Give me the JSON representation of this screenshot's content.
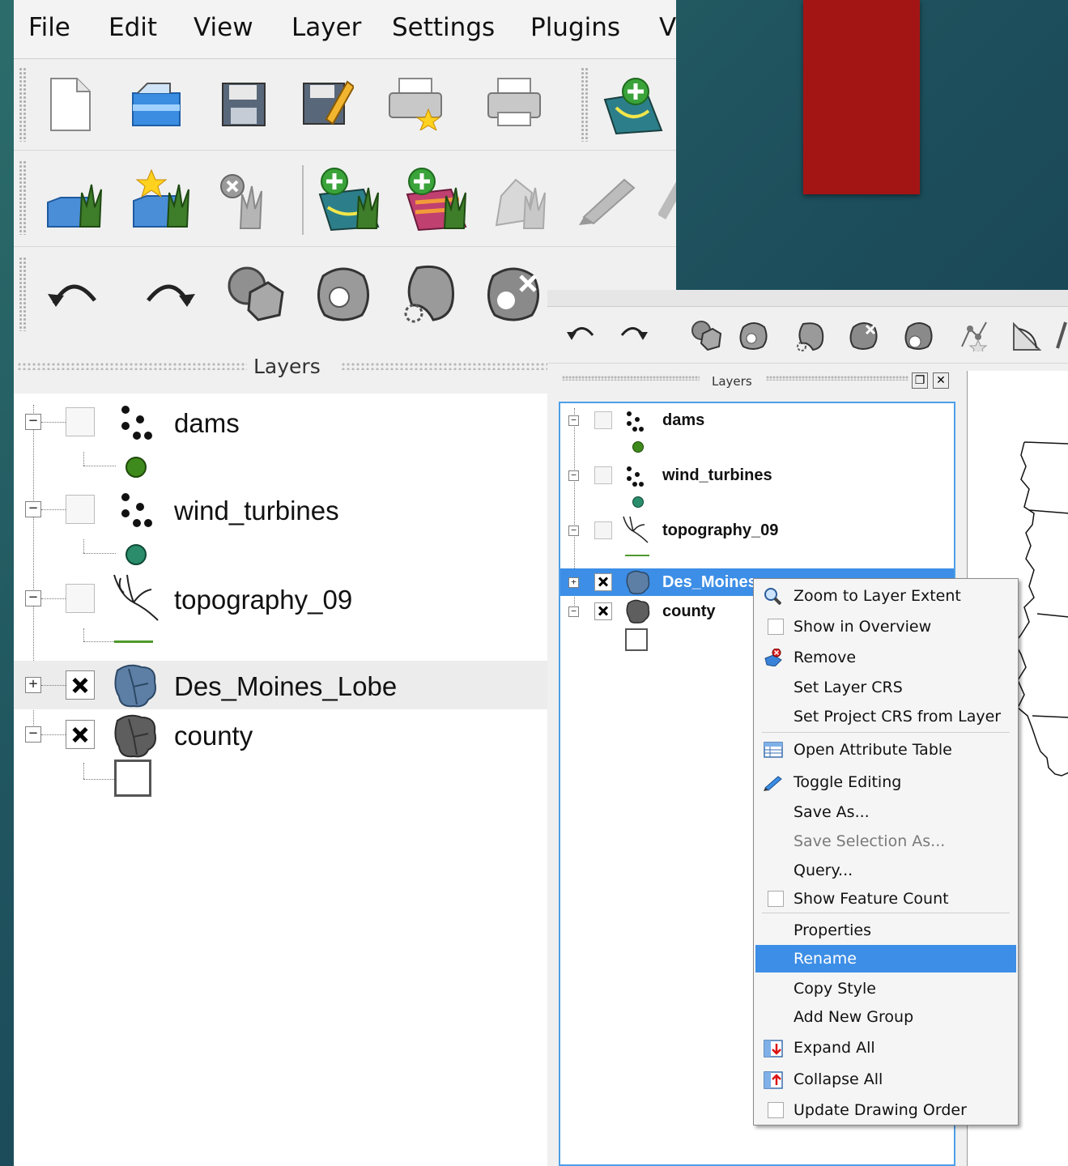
{
  "menubar": {
    "items": [
      "File",
      "Edit",
      "View",
      "Layer",
      "Settings",
      "Plugins",
      "V"
    ]
  },
  "toolbar": {
    "row1_icons": [
      "new-project-icon",
      "open-project-icon",
      "save-project-icon",
      "save-as-icon",
      "new-print-composer-icon",
      "print-icon",
      "add-vector-layer-icon"
    ],
    "row2_icons": [
      "new-shapefile-icon",
      "new-spatialite-icon",
      "remove-layer-icon",
      "add-raster-icon",
      "add-wms-icon",
      "toggle-edit-icon",
      "digitize-icon"
    ],
    "row3_icons": [
      "undo-icon",
      "redo-icon",
      "add-ring-icon",
      "fill-ring-icon",
      "reshape-icon",
      "delete-ring-icon"
    ]
  },
  "layers_panel": {
    "title": "Layers",
    "layers": [
      {
        "name": "dams",
        "checked": false,
        "expanded": true
      },
      {
        "name": "wind_turbines",
        "checked": false,
        "expanded": true
      },
      {
        "name": "topography_09",
        "checked": false,
        "expanded": true
      },
      {
        "name": "Des_Moines_Lobe",
        "checked": true,
        "expanded": false
      },
      {
        "name": "county",
        "checked": true,
        "expanded": true
      }
    ]
  },
  "small_window": {
    "layers_title": "Layers",
    "layers": [
      {
        "name": "dams",
        "checked": false
      },
      {
        "name": "wind_turbines",
        "checked": false
      },
      {
        "name": "topography_09",
        "checked": false
      },
      {
        "name": "Des_Moines",
        "checked": true
      },
      {
        "name": "county",
        "checked": true
      }
    ]
  },
  "context_menu": {
    "items": [
      {
        "label": "Zoom to Layer Extent",
        "icon": "zoom-extent-icon"
      },
      {
        "label": "Show in Overview",
        "icon": "checkbox"
      },
      {
        "label": "Remove",
        "icon": "remove-icon"
      },
      {
        "label": "Set Layer CRS"
      },
      {
        "label": "Set Project CRS from Layer"
      },
      {
        "label": "Open Attribute Table",
        "icon": "table-icon"
      },
      {
        "label": "Toggle Editing",
        "icon": "pencil-icon"
      },
      {
        "label": "Save As..."
      },
      {
        "label": "Save Selection As...",
        "disabled": true
      },
      {
        "label": "Query..."
      },
      {
        "label": "Show Feature Count",
        "icon": "checkbox"
      },
      {
        "label": "Properties"
      },
      {
        "label": "Rename",
        "highlighted": true
      },
      {
        "label": "Copy Style"
      },
      {
        "label": "Add New Group"
      },
      {
        "label": "Expand All",
        "icon": "expand-icon"
      },
      {
        "label": "Collapse All",
        "icon": "collapse-icon"
      },
      {
        "label": "Update Drawing Order",
        "icon": "checkbox"
      }
    ]
  },
  "colors": {
    "selection": "#3d8ee6",
    "background": "#1d4f5c",
    "accent_rect": "#a31515"
  }
}
